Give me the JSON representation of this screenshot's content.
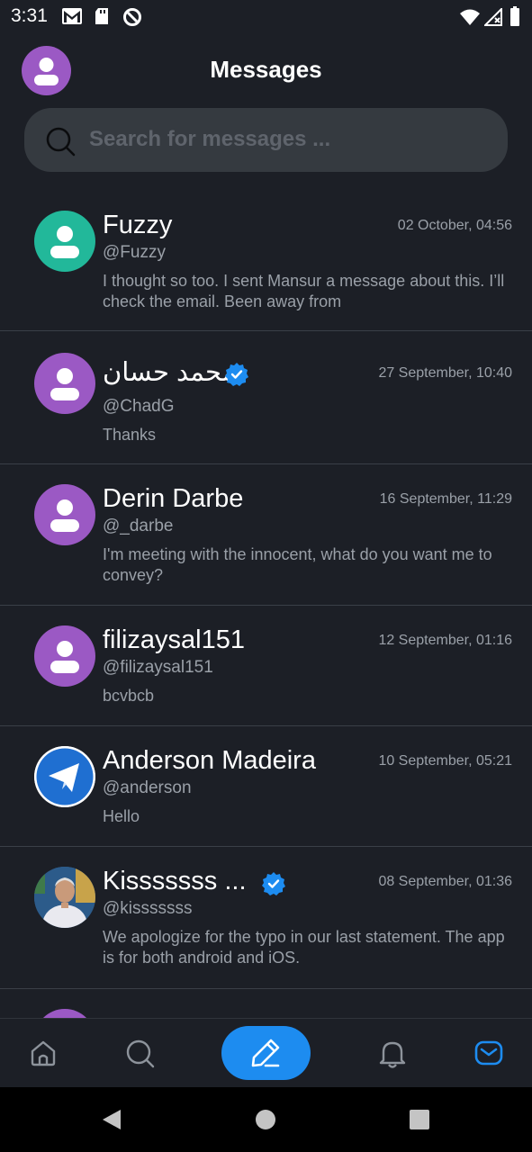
{
  "status_bar": {
    "time": "3:31"
  },
  "header": {
    "title": "Messages"
  },
  "search": {
    "placeholder": "Search for messages ..."
  },
  "conversations": [
    {
      "name": "Fuzzy",
      "handle": "@Fuzzy",
      "time": "02 October, 04:56",
      "message": "I thought so too. I sent Mansur a message about this. I’ll check the email. Been away from",
      "verified": false,
      "avatar": "teal"
    },
    {
      "name": "محمد حسان",
      "handle": "@ChadG",
      "time": "27 September, 10:40",
      "message": "Thanks",
      "verified": true,
      "avatar": "purple"
    },
    {
      "name": "Derin Darbe",
      "handle": "@_darbe",
      "time": "16 September, 11:29",
      "message": "I'm meeting with the innocent, what do you want me to convey?",
      "verified": false,
      "avatar": "purple"
    },
    {
      "name": "filizaysal151",
      "handle": "@filizaysal151",
      "time": "12 September, 01:16",
      "message": "bcvbcb",
      "verified": false,
      "avatar": "purple"
    },
    {
      "name": "Anderson Madeira",
      "handle": "@anderson",
      "time": "10 September, 05:21",
      "message": "Hello",
      "verified": false,
      "avatar": "telegram"
    },
    {
      "name": "Kisssssss ...",
      "handle": "@kisssssss",
      "time": "08 September, 01:36",
      "message": "We apologize for the typo in our last statement. The app is for both android and iOS.",
      "verified": true,
      "avatar": "photo"
    }
  ],
  "nav": {
    "active": "messages",
    "items": [
      "home",
      "search",
      "compose",
      "notifications",
      "messages"
    ]
  },
  "colors": {
    "accent": "#1d8cf0",
    "background": "#1c1f26",
    "avatar_purple": "#9b59c4",
    "avatar_teal": "#22b89a"
  }
}
